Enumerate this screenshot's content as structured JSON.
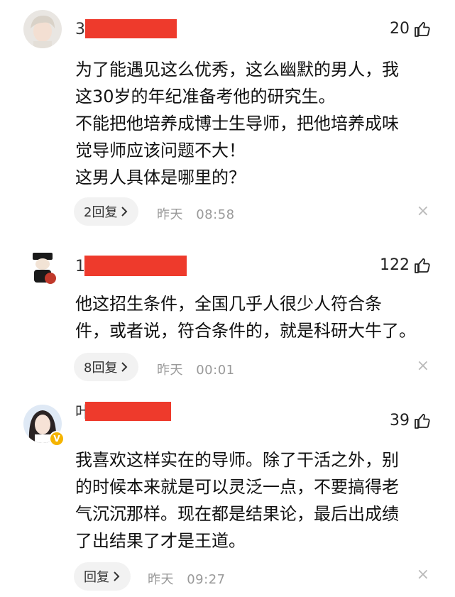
{
  "comments": [
    {
      "username": "3",
      "likes": "20",
      "text": "为了能遇见这么优秀，这么幽默的男人，我\n这30岁的年纪准备考他的研究生。\n不能把他培养成博士生导师，把他培养成味\n觉导师应该问题不大！\n这男人具体是哪里的？",
      "reply_label": "2回复",
      "time_day": "昨天",
      "time_clock": "08:58",
      "close": "×"
    },
    {
      "username": "1",
      "likes": "122",
      "text": "他这招生条件，全国几乎人很少人符合条\n件，或者说，符合条件的，就是科研大牛了。",
      "reply_label": "8回复",
      "time_day": "昨天",
      "time_clock": "00:01",
      "close": "×"
    },
    {
      "username": "叶",
      "likes": "39",
      "text": "我喜欢这样实在的导师。除了干活之外，别\n的时候本来就是可以灵泛一点，不要搞得老\n气沉沉那样。现在都是结果论，最后出成绩\n了出结果了才是王道。",
      "reply_label": "回复",
      "time_day": "昨天",
      "time_clock": "09:27",
      "close": "×"
    }
  ],
  "icons": {
    "like": "thumbs-up-icon",
    "chevron": "chevron-right-icon",
    "close": "close-icon",
    "verified": "verified-badge-icon"
  },
  "colors": {
    "redaction": "#ee3a2c",
    "verified": "#f5b400"
  }
}
